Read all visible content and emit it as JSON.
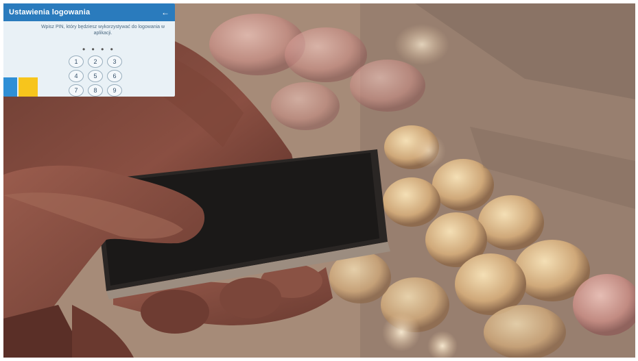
{
  "photo": {
    "description_icon": "hand-holding-smartphone-photo",
    "colors": {
      "app_bar": "#2a7bbd",
      "screen_bg": "#e9f1f6",
      "accent_blue": "#2f8fd6",
      "accent_yellow": "#f7c51c"
    }
  },
  "phone_app": {
    "title": "Ustawienia logowania",
    "back_icon": "arrow-back-icon",
    "hint": "Wpisz PIN, który będziesz wykorzystywać do logowania w aplikacji.",
    "pin_dots": "• • • •",
    "keys": [
      "1",
      "2",
      "3",
      "4",
      "5",
      "6",
      "7",
      "8",
      "9"
    ]
  }
}
